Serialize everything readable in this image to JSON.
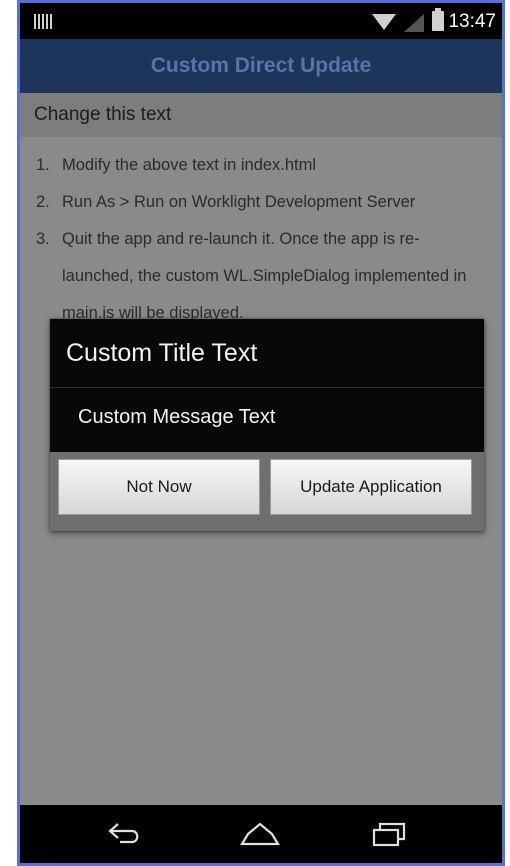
{
  "status_bar": {
    "time": "13:47",
    "icons": [
      "barcode-icon",
      "wifi-icon",
      "signal-icon",
      "battery-icon"
    ]
  },
  "header": {
    "title": "Custom Direct Update"
  },
  "content": {
    "editable_text": "Change this text",
    "steps": [
      {
        "num": "1.",
        "text": "Modify the above text in index.html"
      },
      {
        "num": "2.",
        "text": "Run As > Run on Worklight Development Server"
      },
      {
        "num": "3.",
        "text": "Quit the app and re-launch it. Once the app is re-launched, the custom WL.SimpleDialog implemented in main.js will be displayed."
      }
    ]
  },
  "dialog": {
    "title": "Custom Title Text",
    "message": "Custom Message Text",
    "buttons": {
      "not_now": "Not Now",
      "update": "Update Application"
    }
  },
  "nav_bar": {
    "icons": [
      "back-icon",
      "home-icon",
      "recent-apps-icon"
    ]
  },
  "colors": {
    "header_bg": "#1d3559",
    "frame_border": "#5a6fd6",
    "overlay_bg": "#8a8a8a"
  }
}
